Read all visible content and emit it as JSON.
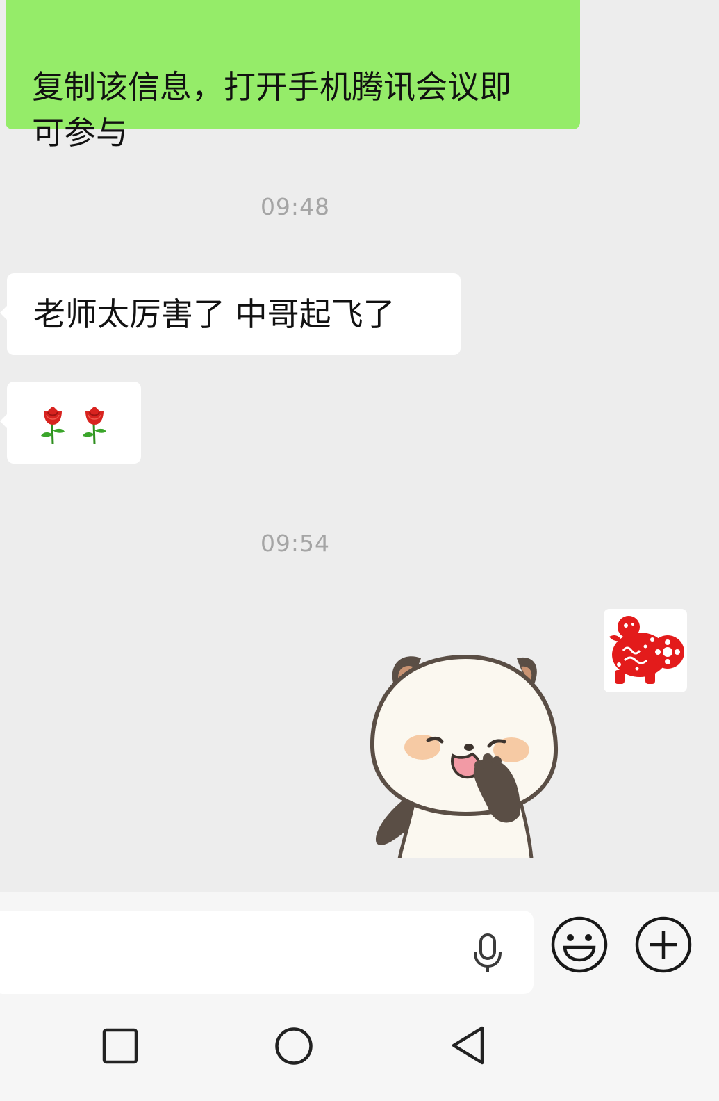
{
  "messages": [
    {
      "side": "right",
      "text": "复制该信息，打开手机腾讯会议即\n可参与"
    },
    {
      "timestamp": "09:48"
    },
    {
      "side": "left",
      "text": "老师太厉害了 中哥起飞了"
    },
    {
      "side": "left",
      "emoji": [
        "rose-emoji",
        "rose-emoji"
      ]
    },
    {
      "timestamp": "09:54"
    },
    {
      "side": "right",
      "sticker": "panda-sticker",
      "avatar": "red-papercut-avatar"
    }
  ],
  "input_bar": {
    "text_value": "",
    "icons": [
      "microphone-icon",
      "smiley-icon",
      "plus-circle-icon"
    ]
  },
  "navigation": {
    "icons": [
      "recents-square-icon",
      "home-circle-icon",
      "back-triangle-icon"
    ]
  },
  "colors": {
    "chat_background": "#ededed",
    "sent_bubble": "#95ec69",
    "received_bubble": "#ffffff",
    "timestamp_text": "#a5a5a5",
    "papercut_red": "#e31b1b"
  }
}
